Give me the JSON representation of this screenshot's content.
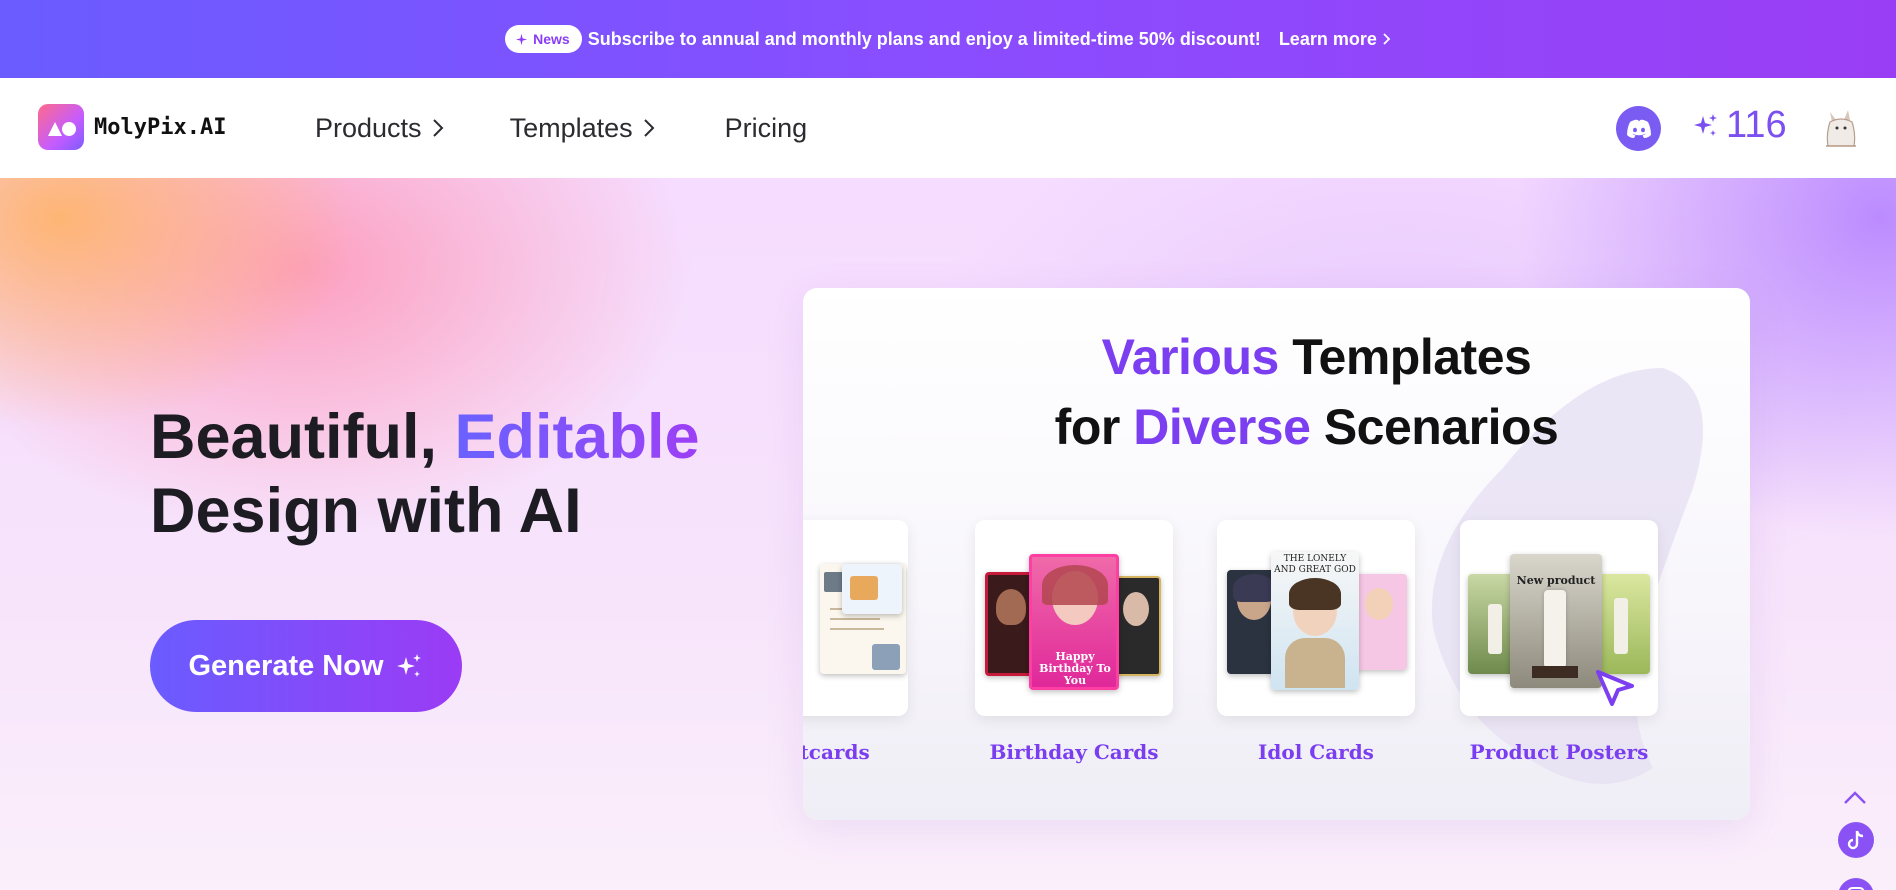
{
  "announcement": {
    "badge": "News",
    "text": "Subscribe to annual and monthly plans and enjoy a limited-time 50% discount!",
    "link": "Learn more"
  },
  "header": {
    "logo_text": "MolyPix.AI",
    "nav": [
      {
        "label": "Products",
        "has_chevron": true
      },
      {
        "label": "Templates",
        "has_chevron": true
      },
      {
        "label": "Pricing",
        "has_chevron": false
      }
    ],
    "credits": "116",
    "icons": [
      "discord-icon",
      "sparkle-icon",
      "avatar"
    ]
  },
  "hero": {
    "headline_part1": "Beautiful, ",
    "headline_accent": "Editable",
    "headline_line2": "Design with AI",
    "cta_label": "Generate Now"
  },
  "showcase": {
    "title_l1_accent": "Various",
    "title_l1_rest": " Templates",
    "title_l2_start": "for ",
    "title_l2_accent": "Diverse",
    "title_l2_rest": " Scenarios",
    "cards": [
      {
        "label": "stcards"
      },
      {
        "label": "Birthday Cards"
      },
      {
        "label": "Idol Cards"
      },
      {
        "label": "Product Posters"
      }
    ],
    "thumb_text": {
      "birthday": "Happy Birthday To You",
      "idol": "THE LONELY AND GREAT GOD",
      "product": "New product"
    }
  },
  "colors": {
    "accent": "#7b3ef0",
    "gradient_start": "#6a5cff",
    "gradient_end": "#9b3bf5"
  }
}
